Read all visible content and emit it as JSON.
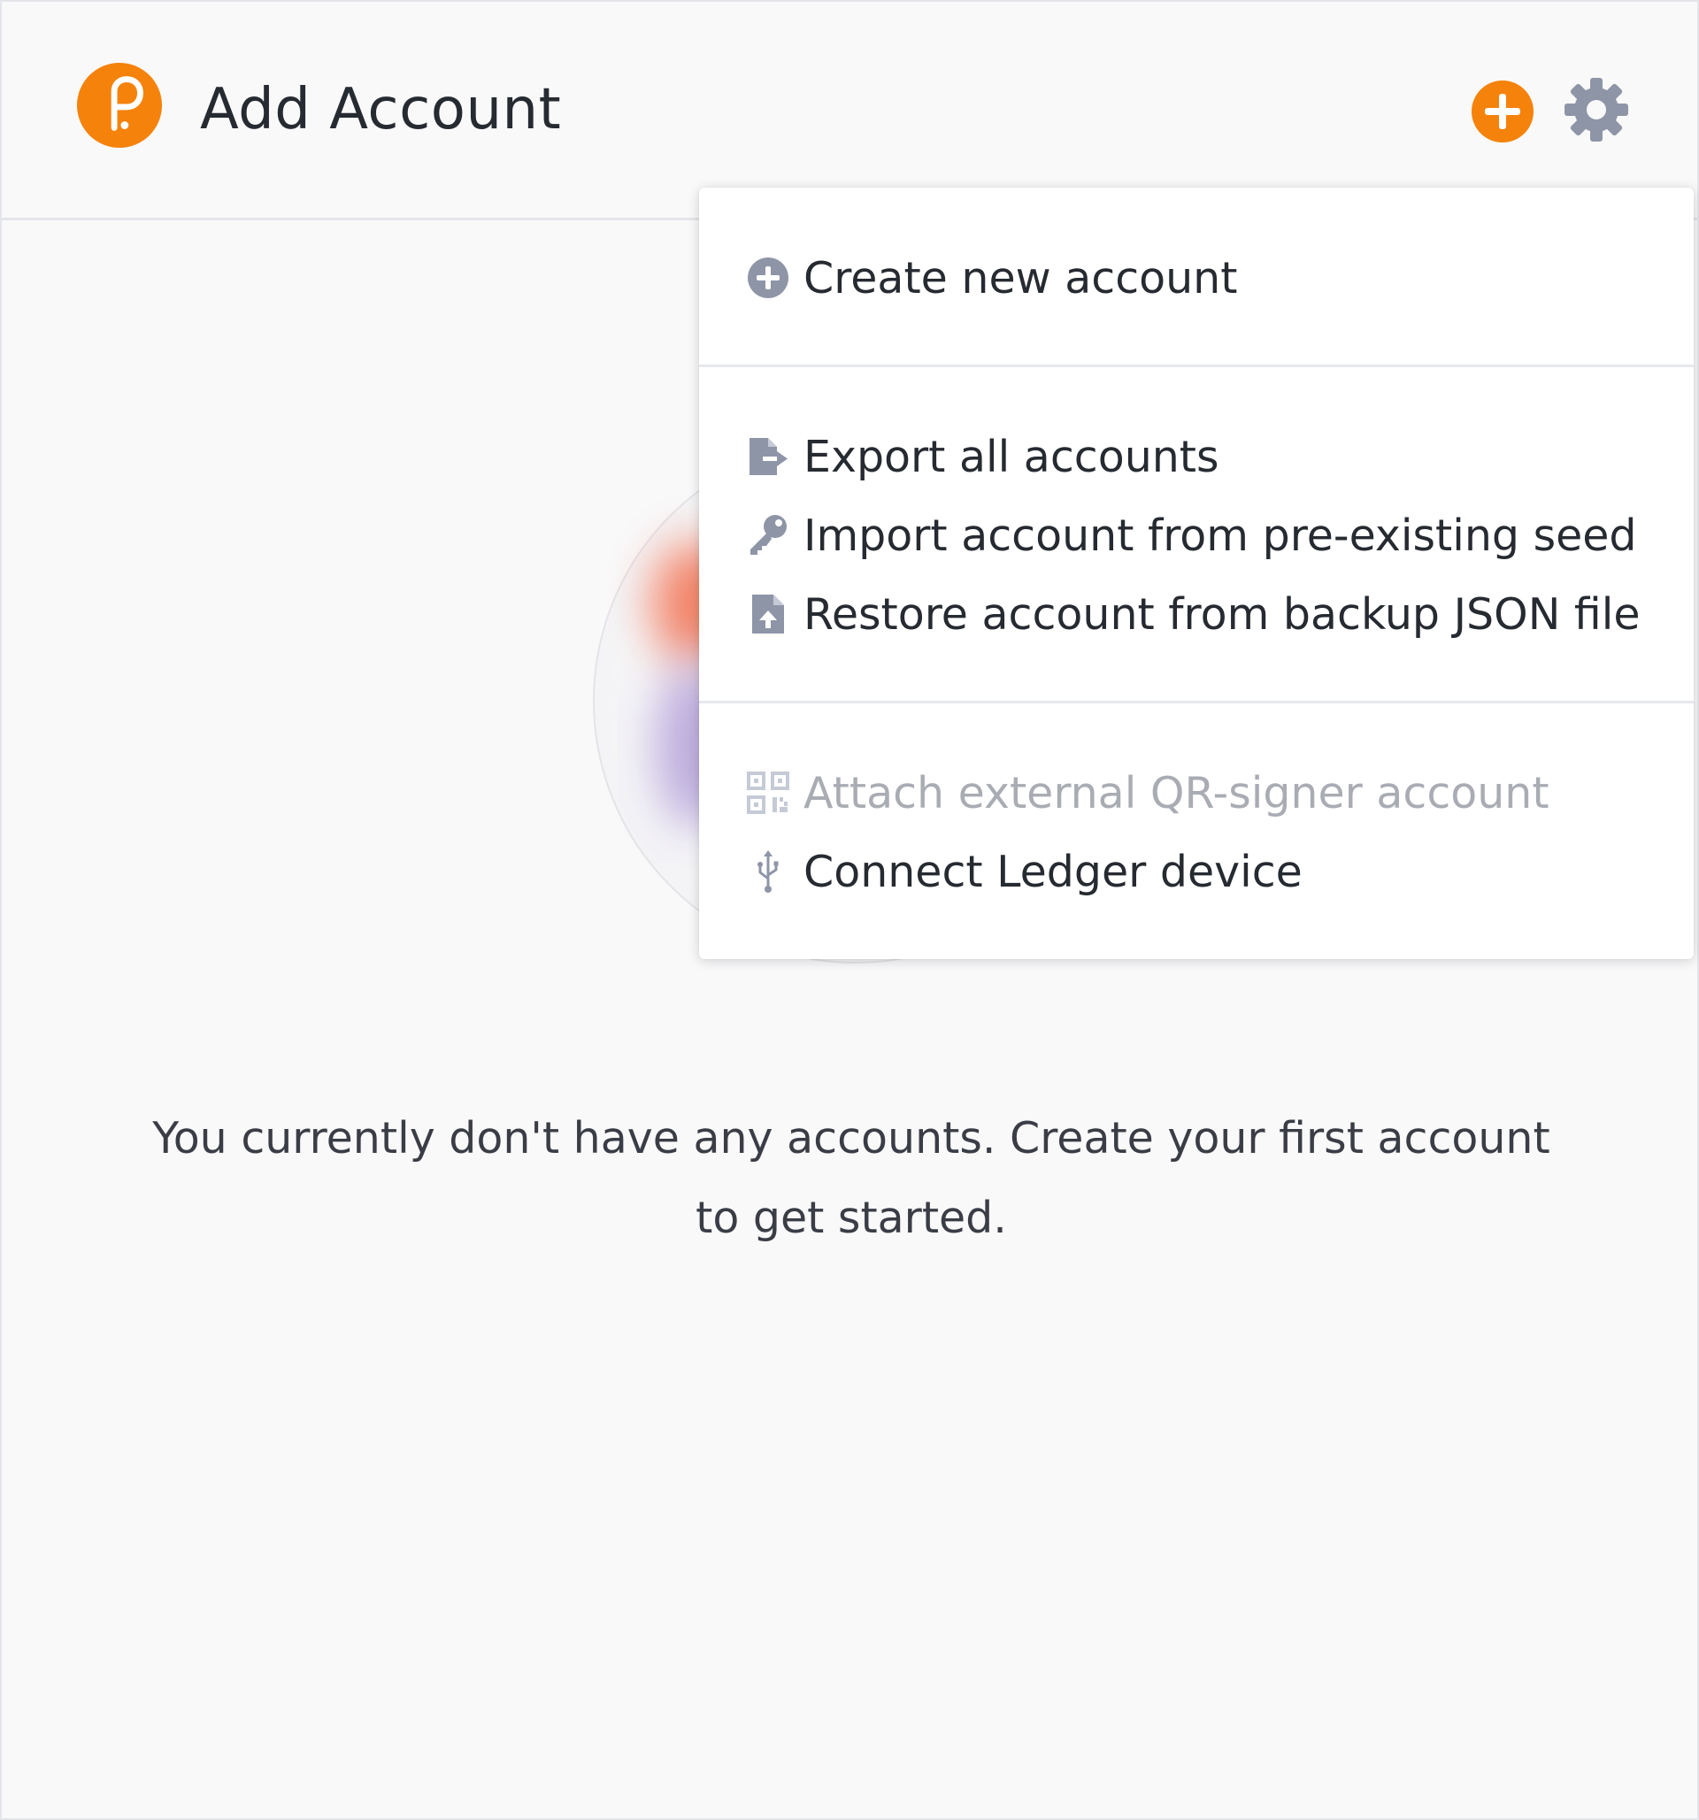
{
  "header": {
    "title": "Add Account",
    "add_icon": "plus-circle-icon",
    "settings_icon": "gear-icon"
  },
  "menu": {
    "groups": [
      {
        "items": [
          {
            "label": "Create new account",
            "icon": "plus-circle-icon",
            "disabled": false
          }
        ]
      },
      {
        "items": [
          {
            "label": "Export all accounts",
            "icon": "file-export-icon",
            "disabled": false
          },
          {
            "label": "Import account from pre-existing seed",
            "icon": "key-icon",
            "disabled": false
          },
          {
            "label": "Restore account from backup JSON file",
            "icon": "file-upload-icon",
            "disabled": false
          }
        ]
      },
      {
        "items": [
          {
            "label": "Attach external QR-signer account",
            "icon": "qrcode-icon",
            "disabled": true
          },
          {
            "label": "Connect Ledger device",
            "icon": "usb-icon",
            "disabled": false
          }
        ]
      }
    ]
  },
  "empty_state": {
    "text": "You currently don't have any accounts. Create your first account to get started."
  },
  "colors": {
    "accent": "#f5820b",
    "icon_gray": "#8e95a7",
    "text": "#262a31",
    "disabled_text": "#a9acb3",
    "background": "#f9f9fa"
  }
}
